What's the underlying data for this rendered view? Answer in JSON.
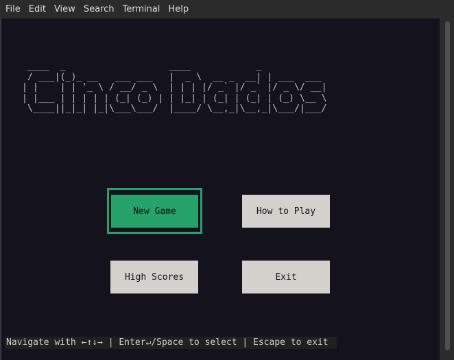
{
  "menubar": {
    "items": [
      "File",
      "Edit",
      "View",
      "Search",
      "Terminal",
      "Help"
    ]
  },
  "title_ascii": " ____  _                   ____            _\n / ___|(_)_ __   ___ ___   |  _ \\  __ _  __| | ___  ___\n| |    | | '_ \\ / __/ _ \\  | | | |/ _` |/ _` |/ _ \\/ __|\n| |___ | | | | | (_| (_) | | |_| | (_| | (_| | (_) \\__ \\\n \\____||_|_| |_|\\___\\___/  |____/ \\__,_|\\__,_|\\___/|___/",
  "buttons": {
    "new_game": "New Game",
    "how_to_play": "How to Play",
    "high_scores": "High Scores",
    "exit": "Exit"
  },
  "selected_button": "new_game",
  "footer": "Navigate with ←↑↓→ | Enter↵/Space to select | Escape to exit",
  "colors": {
    "background": "#14131d",
    "accent": "#25a36b",
    "button": "#d4d1cc",
    "ascii": "#bfbfbf"
  }
}
